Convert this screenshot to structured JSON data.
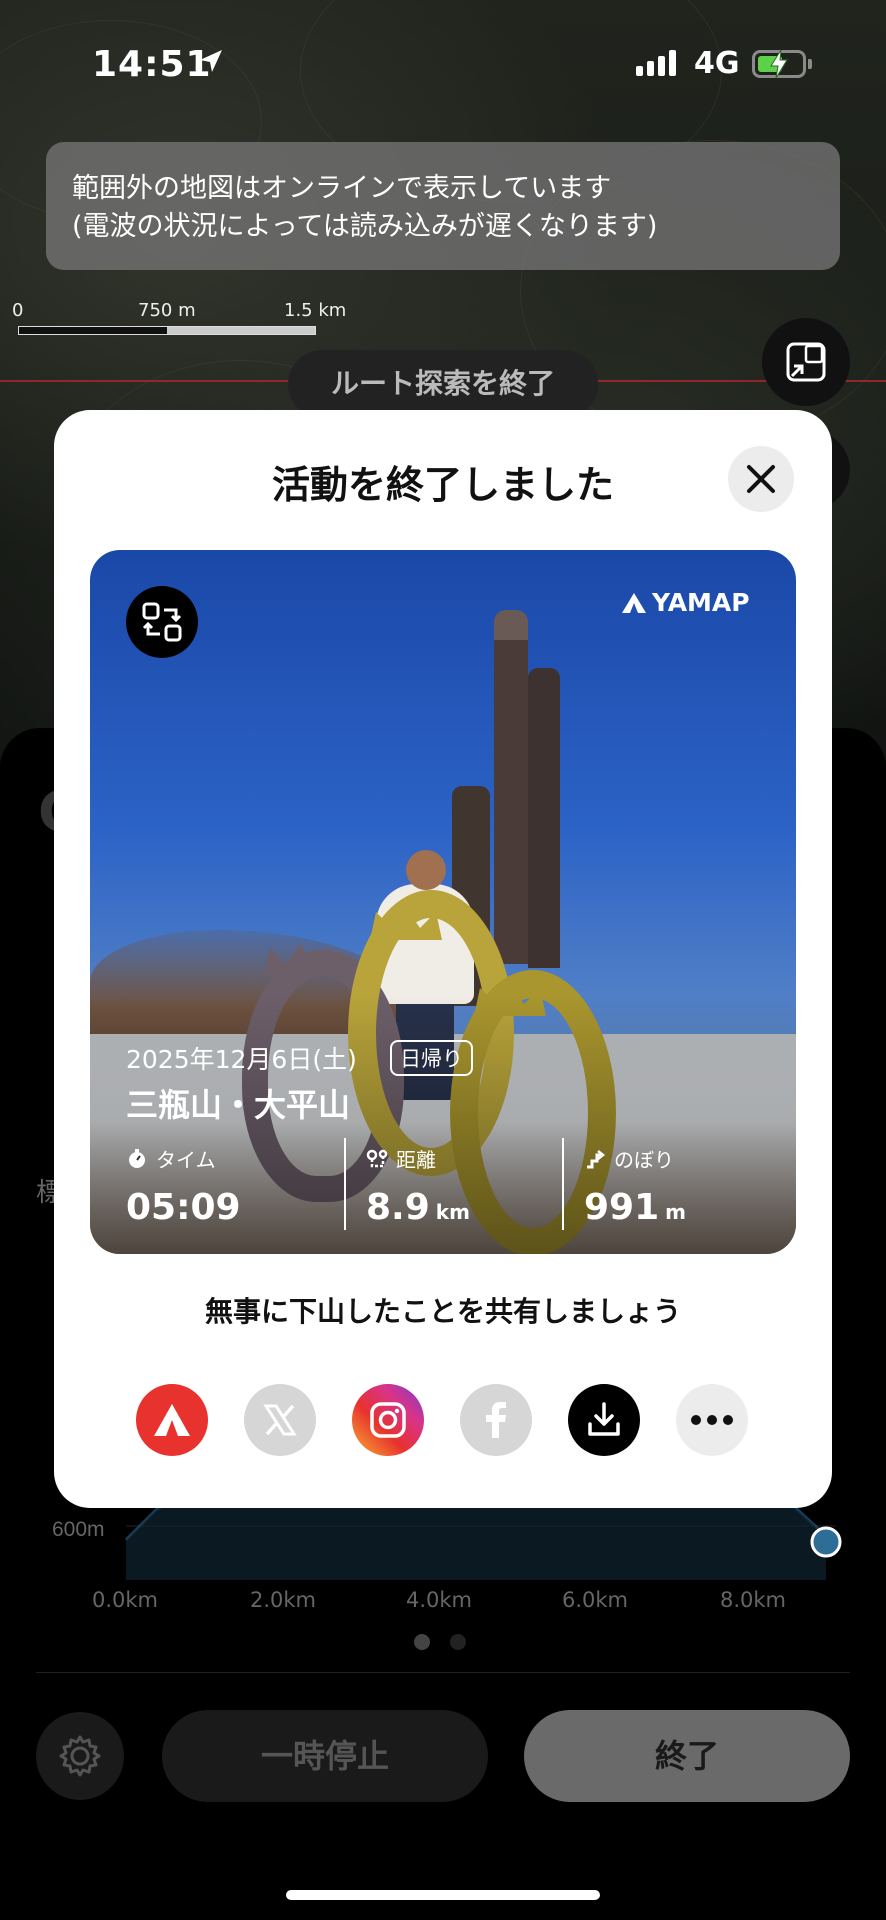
{
  "status_bar": {
    "time": "14:51",
    "network": "4G"
  },
  "map": {
    "notice_line1": "範囲外の地図はオンラインで表示しています",
    "notice_line2": "(電波の状況によっては読み込みが遅くなります)",
    "scale_labels": [
      "0",
      "750 m",
      "1.5 km"
    ],
    "end_route_label": "ルート探索を終了"
  },
  "background_panel": {
    "elevation_label": "標",
    "chart_y_label": "600m",
    "chart_x_labels": [
      "0.0km",
      "2.0km",
      "4.0km",
      "6.0km",
      "8.0km"
    ],
    "pause_label": "一時停止",
    "end_label": "終了"
  },
  "modal": {
    "title": "活動を終了しました",
    "card": {
      "brand": "YAMAP",
      "date": "2025年12月6日(土)",
      "trip_type": "日帰り",
      "mountain": "三瓶山・大平山",
      "stats": [
        {
          "label": "タイム",
          "value": "05:09",
          "unit": "",
          "icon": "stopwatch-icon"
        },
        {
          "label": "距離",
          "value": "8.9",
          "unit": "km",
          "icon": "distance-icon"
        },
        {
          "label": "のぼり",
          "value": "991",
          "unit": "m",
          "icon": "ascent-icon"
        }
      ]
    },
    "share_prompt": "無事に下山したことを共有しましょう",
    "share_buttons": [
      {
        "name": "yamap-share",
        "icon": "yamap-icon",
        "color": "#e8322e"
      },
      {
        "name": "x-share",
        "icon": "x-icon",
        "color": "#cfcfcf"
      },
      {
        "name": "instagram-share",
        "icon": "instagram-icon",
        "color": "#d8338a"
      },
      {
        "name": "facebook-share",
        "icon": "facebook-icon",
        "color": "#cfcfcf"
      },
      {
        "name": "download",
        "icon": "download-icon",
        "color": "#000000"
      },
      {
        "name": "more",
        "icon": "more-icon",
        "color": "#ececec"
      }
    ]
  }
}
